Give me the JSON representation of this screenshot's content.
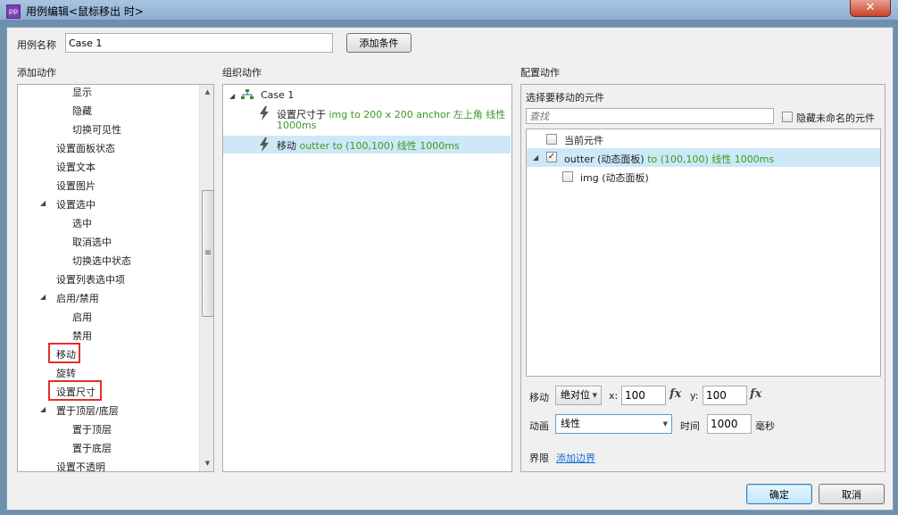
{
  "window": {
    "title": "用例编辑<鼠标移出 时>",
    "close_glyph": "✕",
    "app_icon_text": "pp"
  },
  "case_name": {
    "label": "用例名称",
    "value": "Case 1",
    "add_condition_label": "添加条件"
  },
  "sections": {
    "add_action": "添加动作",
    "organize_action": "组织动作",
    "config_action": "配置动作"
  },
  "action_tree": [
    {
      "label": "显示",
      "indent": 2
    },
    {
      "label": "隐藏",
      "indent": 2
    },
    {
      "label": "切换可见性",
      "indent": 2
    },
    {
      "label": "设置面板状态",
      "indent": 1
    },
    {
      "label": "设置文本",
      "indent": 1
    },
    {
      "label": "设置图片",
      "indent": 1
    },
    {
      "label": "设置选中",
      "indent": 1,
      "expanded": true
    },
    {
      "label": "选中",
      "indent": 2
    },
    {
      "label": "取消选中",
      "indent": 2
    },
    {
      "label": "切换选中状态",
      "indent": 2
    },
    {
      "label": "设置列表选中项",
      "indent": 1
    },
    {
      "label": "启用/禁用",
      "indent": 1,
      "expanded": true
    },
    {
      "label": "启用",
      "indent": 2
    },
    {
      "label": "禁用",
      "indent": 2
    },
    {
      "label": "移动",
      "indent": 1,
      "highlight": true
    },
    {
      "label": "旋转",
      "indent": 1
    },
    {
      "label": "设置尺寸",
      "indent": 1,
      "highlight": true
    },
    {
      "label": "置于顶层/底层",
      "indent": 1,
      "expanded": true
    },
    {
      "label": "置于顶层",
      "indent": 2
    },
    {
      "label": "置于底层",
      "indent": 2
    },
    {
      "label": "设置不透明",
      "indent": 1
    }
  ],
  "organize": {
    "case_label": "Case 1",
    "actions": [
      {
        "verb": "设置尺寸于",
        "detail": "img to 200 x 200 anchor",
        "green": "左上角 线性",
        "line2": "1000ms"
      },
      {
        "verb": "移动",
        "detail": "",
        "green": "outter to (100,100) 线性 1000ms",
        "selected": true
      }
    ]
  },
  "config": {
    "heading": "选择要移动的元件",
    "search_placeholder": "查找",
    "hide_unnamed_label": "隐藏未命名的元件",
    "widgets": [
      {
        "name": "当前元件",
        "detail": "",
        "checked": false,
        "indent": 0
      },
      {
        "name": "outter (动态面板)",
        "detail": "to (100,100) 线性 1000ms",
        "checked": true,
        "indent": 0,
        "expanded": true,
        "selected": true
      },
      {
        "name": "img (动态面板)",
        "detail": "",
        "checked": false,
        "indent": 1
      }
    ],
    "move": {
      "label": "移动",
      "mode": "绝对位",
      "x_label": "x:",
      "x_value": "100",
      "y_label": "y:",
      "y_value": "100",
      "fx": "fx"
    },
    "animate": {
      "label": "动画",
      "value": "线性",
      "time_label": "时间",
      "time_value": "1000",
      "unit": "毫秒"
    },
    "bounds": {
      "label": "界限",
      "link": "添加边界"
    }
  },
  "footer": {
    "ok": "确定",
    "cancel": "取消"
  }
}
